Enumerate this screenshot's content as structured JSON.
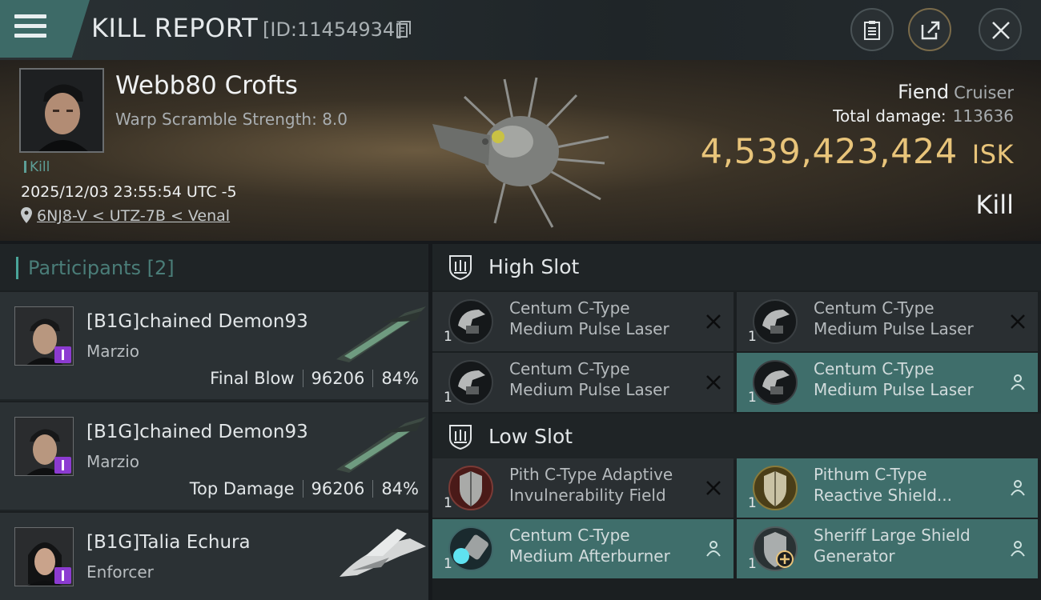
{
  "header": {
    "title": "KILL REPORT",
    "report_id": "[ID:11454934]",
    "menu_icon": "hamburger-menu-icon",
    "buttons": [
      "clipboard-icon",
      "share-icon",
      "close-icon"
    ]
  },
  "victim": {
    "name": "Webb80 Crofts",
    "warp_scramble": "Warp Scramble Strength: 8.0",
    "tag": "Kill",
    "timestamp": "2025/12/03 23:55:54 UTC -5",
    "location": "6NJ8-V < UTZ-7B < Venal",
    "ship_name": "Fiend",
    "ship_class": "Cruiser",
    "total_damage_label": "Total damage:",
    "total_damage": "113636",
    "isk_value": "4,539,423,424",
    "isk_unit": "ISK",
    "result": "Kill"
  },
  "participants": {
    "label": "Participants",
    "count": "[2]",
    "items": [
      {
        "name": "[B1G]chained Demon93",
        "ship": "Marzio",
        "role": "Final Blow",
        "damage": "96206",
        "percent": "84%"
      },
      {
        "name": "[B1G]chained Demon93",
        "ship": "Marzio",
        "role": "Top Damage",
        "damage": "96206",
        "percent": "84%"
      },
      {
        "name": "[B1G]Talia Echura",
        "ship": "Enforcer",
        "role": "",
        "damage": "",
        "percent": ""
      }
    ]
  },
  "fitting": {
    "high_slot": {
      "label": "High Slot",
      "modules": [
        {
          "line1": "Centum C-Type",
          "line2": "Medium Pulse Laser",
          "qty": "1",
          "state": "destroyed"
        },
        {
          "line1": "Centum C-Type",
          "line2": "Medium Pulse Laser",
          "qty": "1",
          "state": "destroyed"
        },
        {
          "line1": "Centum C-Type",
          "line2": "Medium Pulse Laser",
          "qty": "1",
          "state": "destroyed"
        },
        {
          "line1": "Centum C-Type",
          "line2": "Medium Pulse Laser",
          "qty": "1",
          "state": "dropped"
        }
      ]
    },
    "low_slot": {
      "label": "Low Slot",
      "modules": [
        {
          "line1": "Pith C-Type Adaptive",
          "line2": "Invulnerability Field",
          "qty": "1",
          "state": "destroyed"
        },
        {
          "line1": "Pithum C-Type",
          "line2": "Reactive Shield...",
          "qty": "1",
          "state": "dropped"
        },
        {
          "line1": "Centum C-Type",
          "line2": "Medium Afterburner",
          "qty": "1",
          "state": "dropped"
        },
        {
          "line1": "Sheriff Large Shield",
          "line2": "Generator",
          "qty": "1",
          "state": "dropped"
        }
      ]
    }
  }
}
